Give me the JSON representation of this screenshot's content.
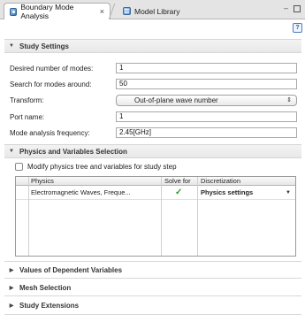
{
  "tabs": [
    {
      "label": "Boundary Mode Analysis",
      "icon": "boundary-mode-analysis-icon",
      "active": true
    },
    {
      "label": "Model Library",
      "icon": "model-library-icon",
      "active": false
    }
  ],
  "tab_close_glyph": "×",
  "sections": {
    "study_settings": {
      "title": "Study Settings",
      "expanded": true
    },
    "physics_selection": {
      "title": "Physics and Variables Selection",
      "expanded": true
    },
    "dependent_vars": {
      "title": "Values of Dependent Variables",
      "expanded": false
    },
    "mesh_selection": {
      "title": "Mesh Selection",
      "expanded": false
    },
    "study_extensions": {
      "title": "Study Extensions",
      "expanded": false
    }
  },
  "study_settings": {
    "modes_label": "Desired number of modes:",
    "modes_value": "1",
    "search_label": "Search for modes around:",
    "search_value": "50",
    "transform_label": "Transform:",
    "transform_value": "Out-of-plane wave number",
    "port_label": "Port name:",
    "port_value": "1",
    "freq_label": "Mode analysis frequency:",
    "freq_value": "2.45[GHz]"
  },
  "physics": {
    "modify_label": "Modify physics tree and variables for study step",
    "modify_checked": false,
    "columns": [
      "Physics",
      "Solve for",
      "Discretization"
    ],
    "rows": [
      {
        "physics": "Electromagnetic Waves, Freque...",
        "solve_for": "✓",
        "discretization": "Physics settings"
      }
    ]
  },
  "colors": {
    "check": "#2e9a2e",
    "tab_bar": "#e4e4e4",
    "section_bg": "#eeeeee"
  }
}
